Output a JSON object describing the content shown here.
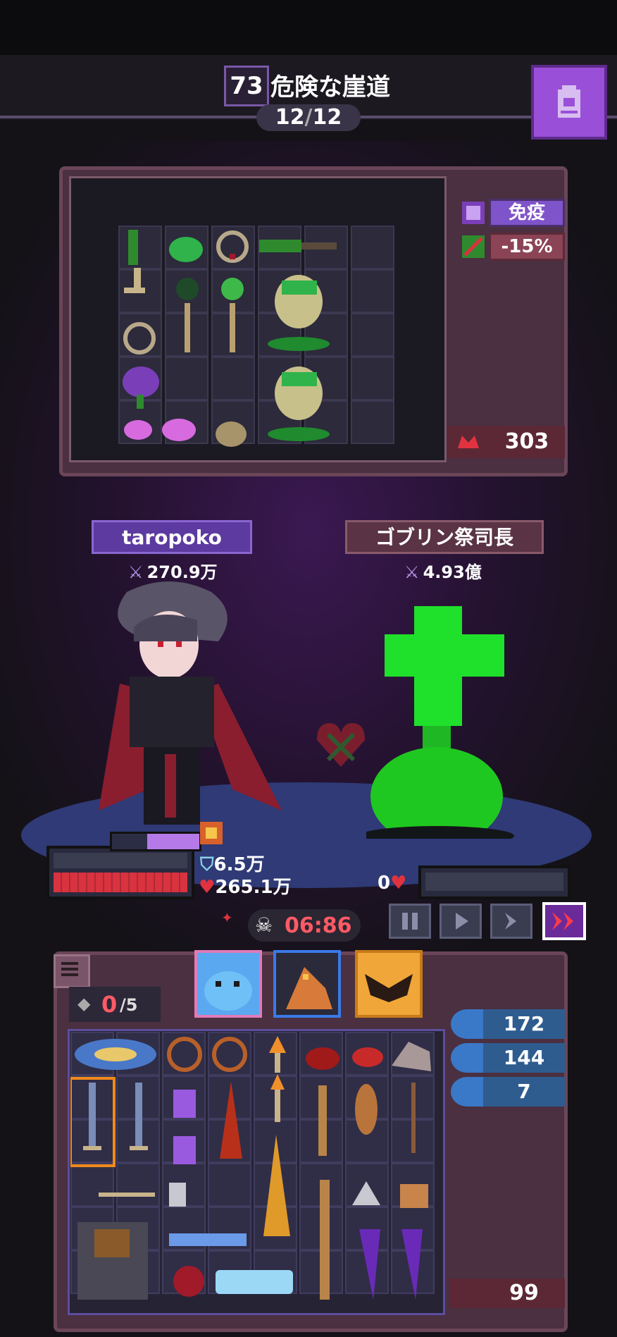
{
  "header": {
    "stage_number": "73",
    "stage_title": "危険な崖道",
    "wave_current": "12",
    "wave_sep": "/",
    "wave_total": "12"
  },
  "enemy_panel": {
    "buffs": [
      {
        "label": "免疫",
        "kind": "buff"
      },
      {
        "label": "-15%",
        "kind": "debuff"
      }
    ],
    "item_count": "303"
  },
  "battle": {
    "player": {
      "name": "taropoko",
      "power": "270.9万",
      "shield": "6.5万",
      "hp": "265.1万"
    },
    "enemy": {
      "name": "ゴブリン祭司長",
      "power": "4.93億",
      "hp": "0"
    },
    "timer": "06:86"
  },
  "inventory": {
    "slots_used": "0",
    "slots_total": "/5",
    "stats": [
      {
        "value": "172",
        "icon": "gem-icon"
      },
      {
        "value": "144",
        "icon": "crossed-bones-icon"
      },
      {
        "value": "7",
        "icon": "monster-face-icon"
      }
    ],
    "bottom_count": "99"
  },
  "colors": {
    "accent_purple": "#7f53c9",
    "enemy_green": "#1fe02a",
    "hp_red": "#d8333f",
    "fast_red": "#d8333f"
  }
}
